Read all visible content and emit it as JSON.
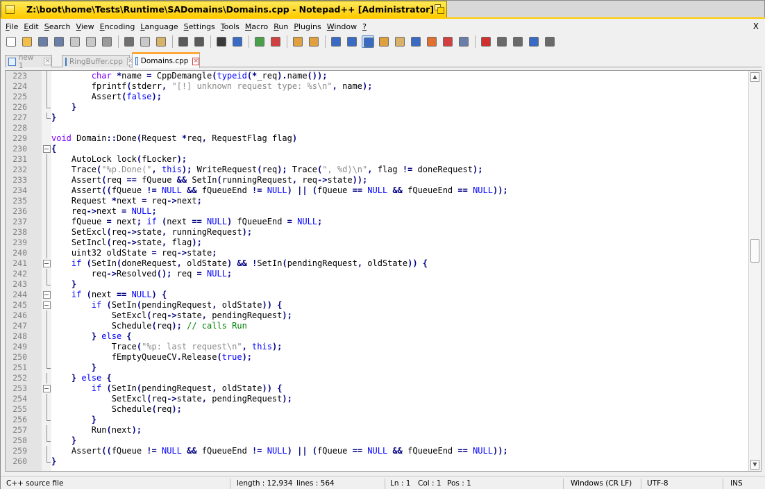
{
  "window": {
    "title": "Z:\\boot\\home\\Tests\\Runtime\\SADomains\\Domains.cpp - Notepad++ [Administrator]"
  },
  "menu": [
    {
      "label": "File",
      "u": "F",
      "rest": "ile"
    },
    {
      "label": "Edit",
      "u": "E",
      "rest": "dit"
    },
    {
      "label": "Search",
      "u": "S",
      "rest": "earch"
    },
    {
      "label": "View",
      "u": "V",
      "rest": "iew"
    },
    {
      "label": "Encoding",
      "u": "E",
      "rest": "ncoding",
      "underlineIndex": 0
    },
    {
      "label": "Language",
      "u": "L",
      "rest": "anguage"
    },
    {
      "label": "Settings",
      "u": "S",
      "rest": "ettings"
    },
    {
      "label": "Tools",
      "u": "T",
      "rest": "ools"
    },
    {
      "label": "Macro",
      "u": "M",
      "rest": "acro"
    },
    {
      "label": "Run",
      "u": "R",
      "rest": "un"
    },
    {
      "label": "Plugins",
      "u": "P",
      "rest": "lugins"
    },
    {
      "label": "Window",
      "u": "W",
      "rest": "indow"
    },
    {
      "label": "?",
      "u": "?",
      "rest": ""
    }
  ],
  "menu_close": "X",
  "toolbar": [
    {
      "name": "new-file-icon",
      "color": "#ffffff"
    },
    {
      "name": "open-file-icon",
      "color": "#f2c04a"
    },
    {
      "name": "save-icon",
      "color": "#6a7fa8"
    },
    {
      "name": "save-all-icon",
      "color": "#6a7fa8"
    },
    {
      "name": "close-icon",
      "color": "#c8c8c8"
    },
    {
      "name": "close-all-icon",
      "color": "#c8c8c8"
    },
    {
      "name": "print-icon",
      "color": "#9a9a9a"
    },
    {
      "name": "sep"
    },
    {
      "name": "cut-icon",
      "color": "#707070"
    },
    {
      "name": "copy-icon",
      "color": "#c8c8c8"
    },
    {
      "name": "paste-icon",
      "color": "#d9b26a"
    },
    {
      "name": "sep"
    },
    {
      "name": "undo-icon",
      "color": "#5a5a5a"
    },
    {
      "name": "redo-icon",
      "color": "#5a5a5a"
    },
    {
      "name": "sep"
    },
    {
      "name": "find-icon",
      "color": "#3a3a3a"
    },
    {
      "name": "replace-icon",
      "color": "#3a6bc4"
    },
    {
      "name": "sep"
    },
    {
      "name": "zoom-in-icon",
      "color": "#4aa04a"
    },
    {
      "name": "zoom-out-icon",
      "color": "#d04040"
    },
    {
      "name": "sep"
    },
    {
      "name": "sync-vertical-icon",
      "color": "#e0a040"
    },
    {
      "name": "sync-horizontal-icon",
      "color": "#e0a040"
    },
    {
      "name": "sep"
    },
    {
      "name": "word-wrap-icon",
      "color": "#3a6bc4"
    },
    {
      "name": "show-all-chars-icon",
      "color": "#3a6bc4"
    },
    {
      "name": "indent-guide-icon",
      "color": "#3a6bc4",
      "active": true
    },
    {
      "name": "udl-icon",
      "color": "#e0a040"
    },
    {
      "name": "doc-map-icon",
      "color": "#d9b26a"
    },
    {
      "name": "function-list-icon",
      "color": "#3a6bc4"
    },
    {
      "name": "folder-workspace-icon",
      "color": "#e07030"
    },
    {
      "name": "doc-list-icon",
      "color": "#d04040"
    },
    {
      "name": "monitoring-icon",
      "color": "#6a7fa8"
    },
    {
      "name": "sep"
    },
    {
      "name": "record-macro-icon",
      "color": "#d03030"
    },
    {
      "name": "stop-record-icon",
      "color": "#6a6a6a"
    },
    {
      "name": "play-macro-icon",
      "color": "#6a6a6a"
    },
    {
      "name": "run-macro-multiple-icon",
      "color": "#3a6bc4"
    },
    {
      "name": "save-macro-icon",
      "color": "#6a6a6a"
    }
  ],
  "tabs": [
    {
      "label": "new 1",
      "active": false
    },
    {
      "label": "RingBuffer.cpp",
      "active": false
    },
    {
      "label": "Domains.cpp",
      "active": true
    }
  ],
  "editor": {
    "lines": [
      {
        "n": "223",
        "fold": "bar",
        "html": "        <span class=\"tp\">char</span> <span class=\"op\">*</span>name <span class=\"op\">=</span> CppDemangle<span class=\"op\">(</span><span class=\"kw\">typeid</span><span class=\"op\">(*</span>_req<span class=\"op\">).</span>name<span class=\"op\">());</span>"
      },
      {
        "n": "224",
        "fold": "bar",
        "html": "        fprintf<span class=\"op\">(</span>stderr<span class=\"op\">,</span> <span class=\"st\">\"[!] unknown request type: %s\\n\"</span><span class=\"op\">,</span> name<span class=\"op\">);</span>"
      },
      {
        "n": "225",
        "fold": "bar",
        "html": "        Assert<span class=\"op\">(</span><span class=\"kw\">false</span><span class=\"op\">);</span>"
      },
      {
        "n": "226",
        "fold": "end",
        "html": "    <span class=\"op\">}</span>"
      },
      {
        "n": "227",
        "fold": "end",
        "html": "<span class=\"op\">}</span>"
      },
      {
        "n": "228",
        "fold": "",
        "html": ""
      },
      {
        "n": "229",
        "fold": "",
        "html": "<span class=\"tp\">void</span> Domain<span class=\"op\">::</span>Done<span class=\"op\">(</span>Request <span class=\"op\">*</span>req<span class=\"op\">,</span> RequestFlag flag<span class=\"op\">)</span>"
      },
      {
        "n": "230",
        "fold": "box",
        "html": "<span class=\"op\">{</span>"
      },
      {
        "n": "231",
        "fold": "bar",
        "html": "    AutoLock lock<span class=\"op\">(</span>fLocker<span class=\"op\">);</span>"
      },
      {
        "n": "232",
        "fold": "bar",
        "html": "    Trace<span class=\"op\">(</span><span class=\"st\">\"%p.Done(\"</span><span class=\"op\">,</span> <span class=\"kw\">this</span><span class=\"op\">);</span> WriteRequest<span class=\"op\">(</span>req<span class=\"op\">);</span> Trace<span class=\"op\">(</span><span class=\"st\">\", %d)\\n\"</span><span class=\"op\">,</span> flag <span class=\"op\">!=</span> doneRequest<span class=\"op\">);</span>"
      },
      {
        "n": "233",
        "fold": "bar",
        "html": "    Assert<span class=\"op\">(</span>req <span class=\"op\">==</span> fQueue <span class=\"op\">&amp;&amp;</span> SetIn<span class=\"op\">(</span>runningRequest<span class=\"op\">,</span> req<span class=\"op\">-&gt;</span>state<span class=\"op\">));</span>"
      },
      {
        "n": "234",
        "fold": "bar",
        "html": "    Assert<span class=\"op\">((</span>fQueue <span class=\"op\">!=</span> <span class=\"kw\">NULL</span> <span class=\"op\">&amp;&amp;</span> fQueueEnd <span class=\"op\">!=</span> <span class=\"kw\">NULL</span><span class=\"op\">)</span> <span class=\"op\">||</span> <span class=\"op\">(</span>fQueue <span class=\"op\">==</span> <span class=\"kw\">NULL</span> <span class=\"op\">&amp;&amp;</span> fQueueEnd <span class=\"op\">==</span> <span class=\"kw\">NULL</span><span class=\"op\">));</span>"
      },
      {
        "n": "235",
        "fold": "bar",
        "html": "    Request <span class=\"op\">*</span>next <span class=\"op\">=</span> req<span class=\"op\">-&gt;</span>next<span class=\"op\">;</span>"
      },
      {
        "n": "236",
        "fold": "bar",
        "html": "    req<span class=\"op\">-&gt;</span>next <span class=\"op\">=</span> <span class=\"kw\">NULL</span><span class=\"op\">;</span>"
      },
      {
        "n": "237",
        "fold": "bar",
        "html": "    fQueue <span class=\"op\">=</span> next<span class=\"op\">;</span> <span class=\"kw\">if</span> <span class=\"op\">(</span>next <span class=\"op\">==</span> <span class=\"kw\">NULL</span><span class=\"op\">)</span> fQueueEnd <span class=\"op\">=</span> <span class=\"kw\">NULL</span><span class=\"op\">;</span>"
      },
      {
        "n": "238",
        "fold": "bar",
        "html": "    SetExcl<span class=\"op\">(</span>req<span class=\"op\">-&gt;</span>state<span class=\"op\">,</span> runningRequest<span class=\"op\">);</span>"
      },
      {
        "n": "239",
        "fold": "bar",
        "html": "    SetIncl<span class=\"op\">(</span>req<span class=\"op\">-&gt;</span>state<span class=\"op\">,</span> flag<span class=\"op\">);</span>"
      },
      {
        "n": "240",
        "fold": "bar",
        "html": "    uint32 oldState <span class=\"op\">=</span> req<span class=\"op\">-&gt;</span>state<span class=\"op\">;</span>"
      },
      {
        "n": "241",
        "fold": "box",
        "html": "    <span class=\"kw\">if</span> <span class=\"op\">(</span>SetIn<span class=\"op\">(</span>doneRequest<span class=\"op\">,</span> oldState<span class=\"op\">)</span> <span class=\"op\">&amp;&amp;</span> <span class=\"op\">!</span>SetIn<span class=\"op\">(</span>pendingRequest<span class=\"op\">,</span> oldState<span class=\"op\">))</span> <span class=\"op\">{</span>"
      },
      {
        "n": "242",
        "fold": "bar",
        "html": "        req<span class=\"op\">-&gt;</span>Resolved<span class=\"op\">();</span> req <span class=\"op\">=</span> <span class=\"kw\">NULL</span><span class=\"op\">;</span>"
      },
      {
        "n": "243",
        "fold": "end",
        "html": "    <span class=\"op\">}</span>"
      },
      {
        "n": "244",
        "fold": "box",
        "html": "    <span class=\"kw\">if</span> <span class=\"op\">(</span>next <span class=\"op\">==</span> <span class=\"kw\">NULL</span><span class=\"op\">)</span> <span class=\"op\">{</span>"
      },
      {
        "n": "245",
        "fold": "box",
        "html": "        <span class=\"kw\">if</span> <span class=\"op\">(</span>SetIn<span class=\"op\">(</span>pendingRequest<span class=\"op\">,</span> oldState<span class=\"op\">))</span> <span class=\"op\">{</span>"
      },
      {
        "n": "246",
        "fold": "bar",
        "html": "            SetExcl<span class=\"op\">(</span>req<span class=\"op\">-&gt;</span>state<span class=\"op\">,</span> pendingRequest<span class=\"op\">);</span>"
      },
      {
        "n": "247",
        "fold": "bar",
        "html": "            Schedule<span class=\"op\">(</span>req<span class=\"op\">);</span> <span class=\"cm\">// calls Run</span>"
      },
      {
        "n": "248",
        "fold": "bar",
        "html": "        <span class=\"op\">}</span> <span class=\"kw\">else</span> <span class=\"op\">{</span>"
      },
      {
        "n": "249",
        "fold": "bar",
        "html": "            Trace<span class=\"op\">(</span><span class=\"st\">\"%p: last request\\n\"</span><span class=\"op\">,</span> <span class=\"kw\">this</span><span class=\"op\">);</span>"
      },
      {
        "n": "250",
        "fold": "bar",
        "html": "            fEmptyQueueCV<span class=\"op\">.</span>Release<span class=\"op\">(</span><span class=\"kw\">true</span><span class=\"op\">);</span>"
      },
      {
        "n": "251",
        "fold": "end",
        "html": "        <span class=\"op\">}</span>"
      },
      {
        "n": "252",
        "fold": "bar",
        "html": "    <span class=\"op\">}</span> <span class=\"kw\">else</span> <span class=\"op\">{</span>"
      },
      {
        "n": "253",
        "fold": "box",
        "html": "        <span class=\"kw\">if</span> <span class=\"op\">(</span>SetIn<span class=\"op\">(</span>pendingRequest<span class=\"op\">,</span> oldState<span class=\"op\">))</span> <span class=\"op\">{</span>"
      },
      {
        "n": "254",
        "fold": "bar",
        "html": "            SetExcl<span class=\"op\">(</span>req<span class=\"op\">-&gt;</span>state<span class=\"op\">,</span> pendingRequest<span class=\"op\">);</span>"
      },
      {
        "n": "255",
        "fold": "bar",
        "html": "            Schedule<span class=\"op\">(</span>req<span class=\"op\">);</span>"
      },
      {
        "n": "256",
        "fold": "end",
        "html": "        <span class=\"op\">}</span>"
      },
      {
        "n": "257",
        "fold": "bar",
        "html": "        Run<span class=\"op\">(</span>next<span class=\"op\">);</span>"
      },
      {
        "n": "258",
        "fold": "end",
        "html": "    <span class=\"op\">}</span>"
      },
      {
        "n": "259",
        "fold": "bar",
        "html": "    Assert<span class=\"op\">((</span>fQueue <span class=\"op\">!=</span> <span class=\"kw\">NULL</span> <span class=\"op\">&amp;&amp;</span> fQueueEnd <span class=\"op\">!=</span> <span class=\"kw\">NULL</span><span class=\"op\">)</span> <span class=\"op\">||</span> <span class=\"op\">(</span>fQueue <span class=\"op\">==</span> <span class=\"kw\">NULL</span> <span class=\"op\">&amp;&amp;</span> fQueueEnd <span class=\"op\">==</span> <span class=\"kw\">NULL</span><span class=\"op\">));</span>"
      },
      {
        "n": "260",
        "fold": "end",
        "html": "<span class=\"op\">}</span>"
      }
    ]
  },
  "scrollbar": {
    "up_glyph": "▲",
    "down_glyph": "▼"
  },
  "status": {
    "file_type": "C++ source file",
    "length": "length : 12,934",
    "lines": "lines : 564",
    "ln": "Ln : 1",
    "col": "Col : 1",
    "pos": "Pos : 1",
    "eol": "Windows (CR LF)",
    "encoding": "UTF-8",
    "mode": "INS"
  }
}
